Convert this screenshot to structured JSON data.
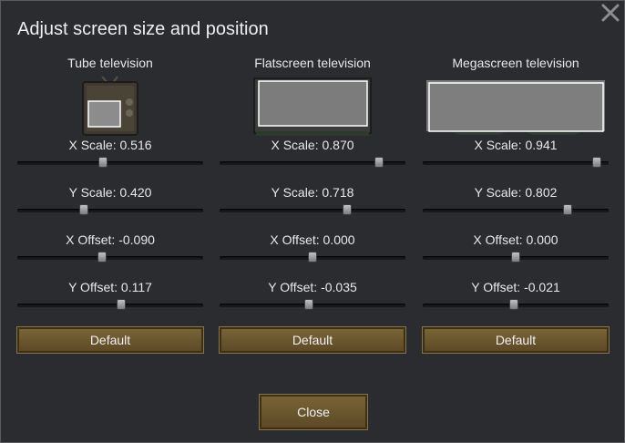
{
  "dialog": {
    "title": "Adjust screen size and position",
    "close_label": "Close"
  },
  "columns": [
    {
      "name": "Tube television",
      "x_scale": "X Scale: 0.516",
      "x_scale_value": 0.516,
      "y_scale": "Y Scale: 0.420",
      "y_scale_value": 0.42,
      "x_offset": "X Offset: -0.090",
      "x_offset_value": -0.09,
      "y_offset": "Y Offset: 0.117",
      "y_offset_value": 0.117,
      "default_label": "Default"
    },
    {
      "name": "Flatscreen television",
      "x_scale": "X Scale: 0.870",
      "x_scale_value": 0.87,
      "y_scale": "Y Scale: 0.718",
      "y_scale_value": 0.718,
      "x_offset": "X Offset: 0.000",
      "x_offset_value": 0.0,
      "y_offset": "Y Offset: -0.035",
      "y_offset_value": -0.035,
      "default_label": "Default"
    },
    {
      "name": "Megascreen television",
      "x_scale": "X Scale: 0.941",
      "x_scale_value": 0.941,
      "y_scale": "Y Scale: 0.802",
      "y_scale_value": 0.802,
      "x_offset": "X Offset: 0.000",
      "x_offset_value": 0.0,
      "y_offset": "Y Offset: -0.021",
      "y_offset_value": -0.021,
      "default_label": "Default"
    }
  ],
  "slider_ranges": {
    "scale": [
      0.1,
      1.0
    ],
    "offset": [
      -1.0,
      1.0
    ]
  },
  "colors": {
    "button": "#6b5630",
    "screen": "#7d7d7d",
    "background": "#2a2c30"
  }
}
